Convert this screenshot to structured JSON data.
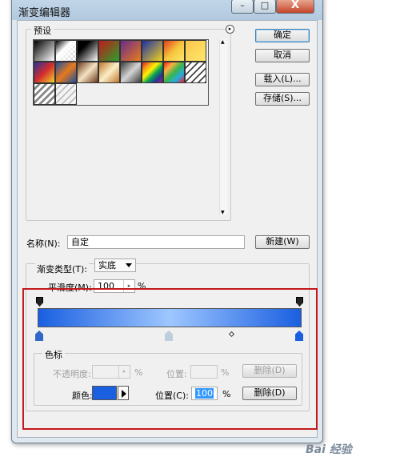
{
  "window": {
    "title": "渐变编辑器",
    "close_glyph": "X"
  },
  "presets": {
    "label": "预设",
    "swatches": [
      "linear-gradient(135deg,#000,#fff)",
      "linear-gradient(135deg,#000,#fff 40%,transparent)",
      "linear-gradient(135deg,#000,#000 30%,#fff)",
      "linear-gradient(135deg,#c21a1a,#2ca02c)",
      "linear-gradient(135deg,#6a2b8c,#e87c1c)",
      "linear-gradient(135deg,#1d2fa8,#f2d21c)",
      "linear-gradient(135deg,#e23a1c,#f6c53c,#fbe96a)",
      "linear-gradient(135deg,#f9c74a,#ffe66b)",
      "linear-gradient(135deg,#2b2f9c,#d32c2c,#f2d22c)",
      "linear-gradient(135deg,#1f4f9f,#e87a1a,#1f4f9f)",
      "linear-gradient(135deg,#6d3b1e,#f5e1c3,#6d3b1e)",
      "linear-gradient(135deg,#c1772c,#fbeec6,#c1772c)",
      "linear-gradient(135deg,#3c3c3c,#d4d4d4,#3c3c3c)",
      "linear-gradient(135deg,#d81f26,#f7941d,#fff200,#00a651,#2e3192,#92278f)",
      "linear-gradient(135deg,#ed1c24,#fbb040,#39b54a,#27aae1,#ed1c24)",
      "repeating-linear-gradient(135deg,#fff 0 4px,#444 4px 6px)",
      "repeating-linear-gradient(135deg,#fff 0 3px,#888 3px 6px)",
      "repeating-linear-gradient(135deg,#f4f4f4 0 4px,#bdbdbd 4px 6px)"
    ]
  },
  "buttons": {
    "ok": "确定",
    "cancel": "取消",
    "load": "载入(L)...",
    "save": "存储(S)...",
    "new": "新建(W)"
  },
  "name_field": {
    "label": "名称(N):",
    "value": "自定"
  },
  "gradient_type": {
    "label": "渐变类型(T):",
    "value": "实底"
  },
  "smoothness": {
    "label": "平滑度(M):",
    "value": "100",
    "unit": "%"
  },
  "gradient_colors": {
    "start": "#1a5fe0",
    "mid": "#9ec7ff",
    "end": "#1a5fe0",
    "midpoint": 0.5
  },
  "color_stops": {
    "label": "色标",
    "opacity_label": "不透明度:",
    "opacity_unit": "%",
    "opacity_location_label": "位置:",
    "opacity_location_unit": "%",
    "delete_label": "删除(D)",
    "color_label": "颜色:",
    "color_value": "#1a5fe0",
    "location_label": "位置(C):",
    "location_value": "100",
    "location_unit": "%"
  },
  "watermark": "Bai 经验"
}
